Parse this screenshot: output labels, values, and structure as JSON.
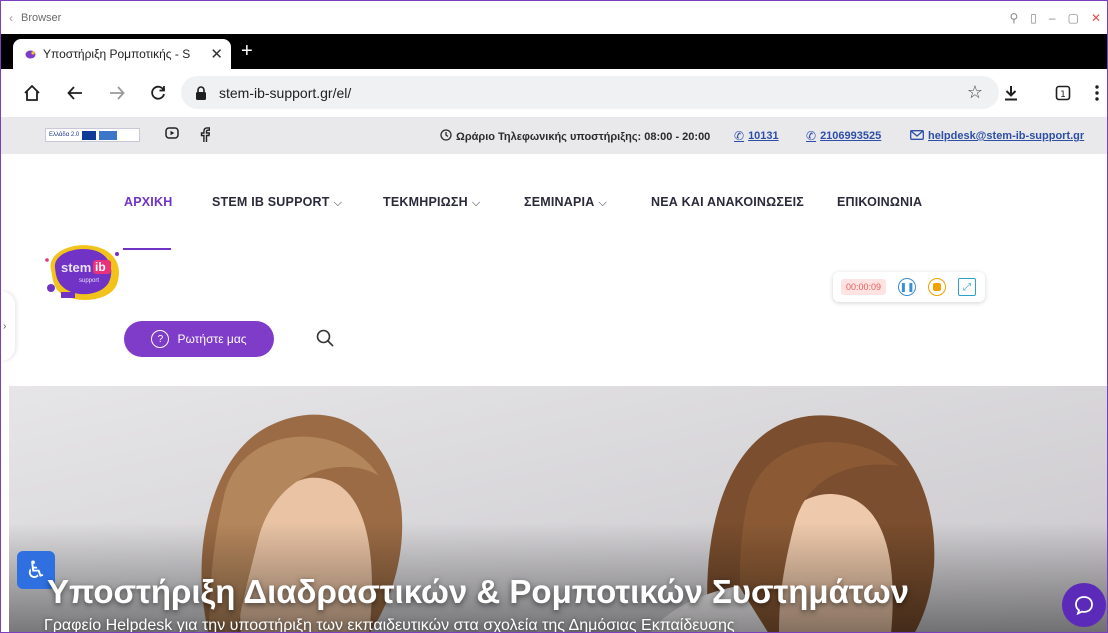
{
  "os": {
    "title": "Browser",
    "back_glyph": "‹",
    "controls": [
      "⚲",
      "▯",
      "–",
      "▢",
      "✕"
    ]
  },
  "tab": {
    "title": "Υποστήριξη Ρομποτικής - S",
    "close": "✕",
    "new_tab": "+"
  },
  "toolbar": {
    "url": "stem-ib-support.gr/el/",
    "icons": [
      "home-icon",
      "back-icon",
      "forward-icon",
      "reload-icon",
      "lock-icon",
      "star-icon",
      "download-icon",
      "tab-count-icon",
      "more-icon"
    ]
  },
  "infobar": {
    "flag_text": "Ελλάδα 2.0",
    "hours": "Ωράριο Τηλεφωνικής υποστήριξης: 08:00 - 20:00",
    "phone1": "10131",
    "phone2": "2106993525",
    "email": "helpdesk@stem-ib-support.gr"
  },
  "nav": {
    "items": [
      {
        "label": "ΑΡΧΙΚΗ",
        "has_menu": false
      },
      {
        "label": "STEM IB SUPPORT",
        "has_menu": true
      },
      {
        "label": "ΤΕΚΜΗΡΙΩΣΗ",
        "has_menu": true
      },
      {
        "label": "ΣΕΜΙΝΑΡΙΑ",
        "has_menu": true
      },
      {
        "label": "ΝΕΑ ΚΑΙ ΑΝΑΚΟΙΝΩΣΕΙΣ",
        "has_menu": false
      },
      {
        "label": "ΕΠΙΚΟΙΝΩΝΙΑ",
        "has_menu": false
      }
    ],
    "chevron": "⌵"
  },
  "logo": {
    "word1": "stem",
    "word2": "ib",
    "word3": "support"
  },
  "recorder": {
    "timer": "00:00:09"
  },
  "ask": {
    "label": "Ρωτήστε μας",
    "icon_glyph": "?"
  },
  "hero": {
    "title": "Υποστήριξη Διαδραστικών & Ρομποτικών Συστημάτων",
    "subtitle": "Γραφείο Helpdesk για την υποστήριξη των εκπαιδευτικών στα σχολεία της Δημόσιας Εκπαίδευσης"
  },
  "colors": {
    "brand": "#7e3cc9",
    "accent_blue": "#2e4ea6",
    "a11y": "#2f6fe0"
  }
}
